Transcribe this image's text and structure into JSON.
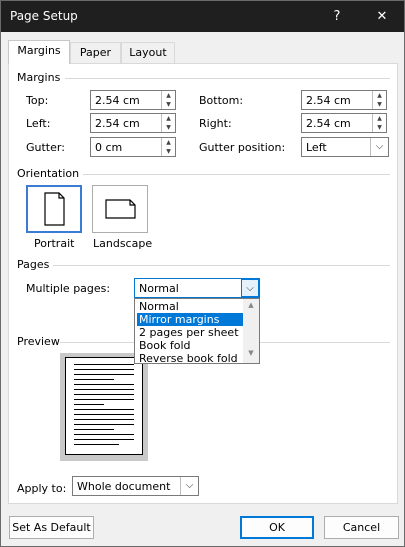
{
  "window": {
    "title": "Page Setup",
    "help_label": "?",
    "close_label": "✕"
  },
  "tabs": [
    {
      "label": "Margins",
      "active": true
    },
    {
      "label": "Paper",
      "active": false
    },
    {
      "label": "Layout",
      "active": false
    }
  ],
  "margins": {
    "section_label": "Margins",
    "top": {
      "label": "Top:",
      "value": "2.54 cm"
    },
    "bottom": {
      "label": "Bottom:",
      "value": "2.54 cm"
    },
    "left": {
      "label": "Left:",
      "value": "2.54 cm"
    },
    "right": {
      "label": "Right:",
      "value": "2.54 cm"
    },
    "gutter": {
      "label": "Gutter:",
      "value": "0 cm"
    },
    "gutter_position": {
      "label": "Gutter position:",
      "value": "Left"
    }
  },
  "orientation": {
    "section_label": "Orientation",
    "portrait_label": "Portrait",
    "landscape_label": "Landscape",
    "selected": "Portrait"
  },
  "pages": {
    "section_label": "Pages",
    "multiple_pages_label": "Multiple pages:",
    "multiple_pages_value": "Normal",
    "options": [
      "Normal",
      "Mirror margins",
      "2 pages per sheet",
      "Book fold",
      "Reverse book fold"
    ],
    "highlighted_option": "Mirror margins"
  },
  "preview": {
    "section_label": "Preview"
  },
  "apply_to": {
    "label": "Apply to:",
    "value": "Whole document"
  },
  "buttons": {
    "set_default": "Set As Default",
    "ok": "OK",
    "cancel": "Cancel"
  },
  "colors": {
    "accent": "#0078d7",
    "titlebar": "#1f1f1f",
    "selected_border": "#3c7bd4"
  },
  "icons": [
    "help-icon",
    "close-icon",
    "portrait-icon",
    "landscape-icon",
    "chevron-down-icon",
    "spin-up-icon",
    "spin-down-icon"
  ]
}
